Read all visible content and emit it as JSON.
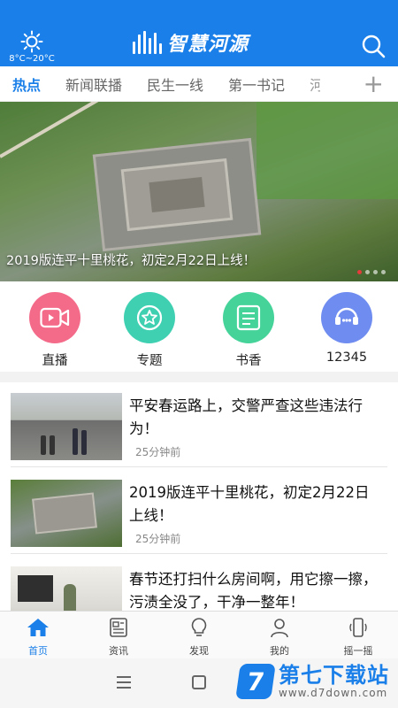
{
  "header": {
    "weather_temp": "8°C~20°C",
    "app_title": "智慧河源",
    "accent_color": "#1a7fe8",
    "search_icon": "search-icon"
  },
  "tabs": [
    {
      "label": "热点",
      "active": true
    },
    {
      "label": "新闻联播"
    },
    {
      "label": "民生一线"
    },
    {
      "label": "第一书记"
    },
    {
      "label": "河"
    }
  ],
  "banner": {
    "caption": "2019版连平十里桃花，初定2月22日上线！",
    "slides_total": 4,
    "active_slide": 1
  },
  "quick_links": [
    {
      "label": "直播",
      "icon": "video-camera-icon",
      "color": "#f46b8a"
    },
    {
      "label": "专题",
      "icon": "star-icon",
      "color": "#3fd0b2"
    },
    {
      "label": "书香",
      "icon": "book-icon",
      "color": "#45d39a"
    },
    {
      "label": "12345",
      "icon": "headset-icon",
      "color": "#6f8cf0"
    }
  ],
  "news": [
    {
      "title": "平安春运路上，交警严查这些违法行为！",
      "time": "25分钟前"
    },
    {
      "title": "2019版连平十里桃花，初定2月22日上线！",
      "time": "25分钟前"
    },
    {
      "title": "春节还打扫什么房间啊，用它擦一擦，污渍全没了，干净一整年！",
      "time": ""
    }
  ],
  "bottom_nav": [
    {
      "label": "首页",
      "icon": "home-icon",
      "active": true
    },
    {
      "label": "资讯",
      "icon": "newspaper-icon"
    },
    {
      "label": "发现",
      "icon": "bulb-icon"
    },
    {
      "label": "我的",
      "icon": "user-icon"
    },
    {
      "label": "摇一摇",
      "icon": "shake-phone-icon"
    }
  ],
  "watermark": {
    "logo": "7",
    "name": "第七下载站",
    "url": "www.d7down.com"
  }
}
